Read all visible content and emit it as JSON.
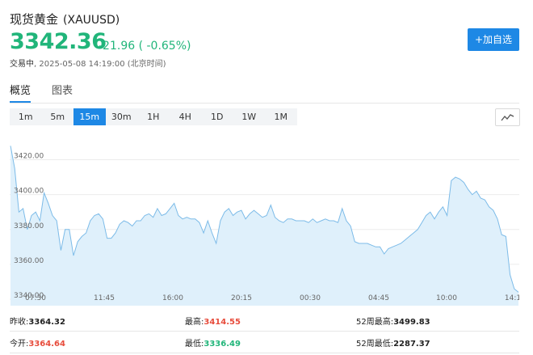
{
  "header": {
    "name": "现货黄金",
    "symbol": "(XAUUSD)",
    "price": "3342.36",
    "change": "-21.96 ( -0.65%)",
    "status_label": "交易中",
    "timestamp": ", 2025-05-08 14:19:00 (北京时间)",
    "add_button": "+加自选"
  },
  "tabs": [
    {
      "label": "概览",
      "active": true
    },
    {
      "label": "图表",
      "active": false
    }
  ],
  "ranges": [
    "1m",
    "5m",
    "15m",
    "30m",
    "1H",
    "4H",
    "1D",
    "1W",
    "1M"
  ],
  "active_range": "15m",
  "colors": {
    "accent": "#1e88e5",
    "up": "#e74c3c",
    "down": "#21b57a",
    "area": "#dff0fb",
    "line": "#7cbbe8"
  },
  "chart_data": {
    "type": "area",
    "y_ticks": [
      "3420.00",
      "3400.00",
      "3380.00",
      "3360.00",
      "3340.00"
    ],
    "y_values": [
      3420,
      3400,
      3380,
      3360,
      3340
    ],
    "x_ticks": [
      "07:30",
      "11:45",
      "16:00",
      "20:15",
      "00:30",
      "04:45",
      "10:00",
      "14:1"
    ],
    "ylim": [
      3340,
      3430
    ],
    "grid": true,
    "values": [
      3428,
      3415,
      3390,
      3392,
      3380,
      3388,
      3390,
      3385,
      3401,
      3395,
      3388,
      3385,
      3368,
      3380,
      3380,
      3365,
      3373,
      3376,
      3378,
      3385,
      3388,
      3389,
      3386,
      3375,
      3375,
      3378,
      3383,
      3385,
      3384,
      3382,
      3385,
      3385,
      3388,
      3389,
      3387,
      3392,
      3388,
      3389,
      3392,
      3395,
      3388,
      3386,
      3387,
      3386,
      3386,
      3384,
      3378,
      3385,
      3378,
      3372,
      3385,
      3390,
      3392,
      3388,
      3390,
      3391,
      3386,
      3389,
      3391,
      3389,
      3387,
      3388,
      3394,
      3387,
      3385,
      3384,
      3386,
      3386,
      3385,
      3385,
      3385,
      3384,
      3386,
      3384,
      3385,
      3386,
      3385,
      3385,
      3384,
      3392,
      3385,
      3382,
      3373,
      3372,
      3372,
      3372,
      3371,
      3370,
      3370,
      3366,
      3369,
      3370,
      3371,
      3372,
      3374,
      3376,
      3378,
      3380,
      3384,
      3388,
      3390,
      3386,
      3390,
      3393,
      3388,
      3408,
      3410,
      3409,
      3407,
      3403,
      3400,
      3402,
      3398,
      3397,
      3393,
      3391,
      3386,
      3377,
      3376,
      3354,
      3346,
      3344
    ]
  },
  "stats": {
    "r1": [
      {
        "label": "昨收:",
        "value": "3364.32",
        "tone": "normal"
      },
      {
        "label": "最高:",
        "value": "3414.55",
        "tone": "up"
      },
      {
        "label": "52周最高:",
        "value": "3499.83",
        "tone": "normal"
      }
    ],
    "r2": [
      {
        "label": "今开:",
        "value": "3364.64",
        "tone": "up"
      },
      {
        "label": "最低:",
        "value": "3336.49",
        "tone": "down"
      },
      {
        "label": "52周最低:",
        "value": "2287.37",
        "tone": "normal"
      }
    ]
  }
}
